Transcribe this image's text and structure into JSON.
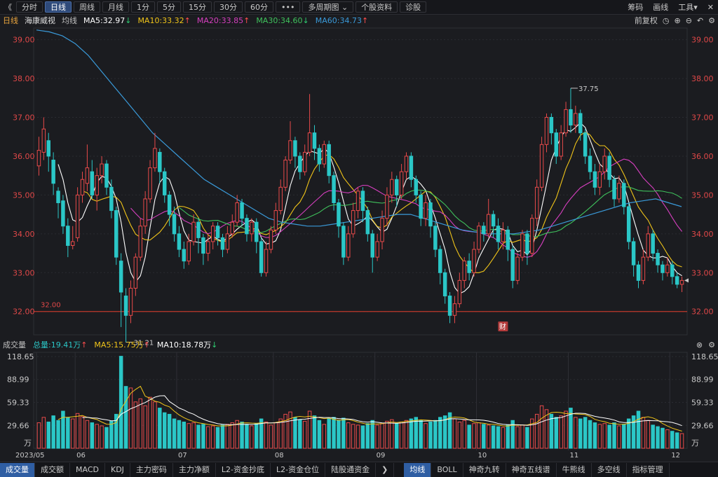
{
  "toolbar": {
    "back": "《",
    "tabs": [
      "分时",
      "日线",
      "周线",
      "月线",
      "1分",
      "5分",
      "15分",
      "30分",
      "60分",
      "•••",
      "多周期图 ⌄",
      "个股资料",
      "诊股"
    ],
    "active_tab": 1,
    "right_items": [
      "筹码",
      "画线",
      "工具▾"
    ],
    "close": "✕"
  },
  "legend": {
    "period": "日线",
    "stock_name": "海康威视",
    "ma_label": "均线",
    "ma": [
      {
        "text": "MA5:32.97",
        "arrow": "↓",
        "color": "#ffffff",
        "arrow_color": "#2ecc71"
      },
      {
        "text": "MA10:33.32",
        "arrow": "↑",
        "color": "#f0c419",
        "arrow_color": "#ff4d4d"
      },
      {
        "text": "MA20:33.85",
        "arrow": "↑",
        "color": "#d63fbf",
        "arrow_color": "#ff4d4d"
      },
      {
        "text": "MA30:34.60",
        "arrow": "↓",
        "color": "#3fc25c",
        "arrow_color": "#2ecc71"
      },
      {
        "text": "MA60:34.73",
        "arrow": "↑",
        "color": "#3a9ad9",
        "arrow_color": "#ff4d4d"
      }
    ],
    "right": [
      "前复权",
      "◷",
      "⊕",
      "⊖",
      "↶",
      "⚙"
    ]
  },
  "volume_legend": {
    "label": "成交量",
    "total": "总量:19.41万",
    "total_arrow": "↑",
    "ma5": "MA5:15.75万",
    "ma5_arrow": "↑",
    "ma10": "MA10:18.78万",
    "ma10_arrow": "↓",
    "right": [
      "⊗",
      "⚙"
    ]
  },
  "price_axis": {
    "ticks": [
      "39.00",
      "38.00",
      "37.00",
      "36.00",
      "35.00",
      "34.00",
      "33.00",
      "32.00"
    ],
    "reference_line_label": "32.00",
    "high_label": "37.75",
    "low_label": "31.21",
    "event_marker": "财"
  },
  "volume_axis": {
    "ticks": [
      "118.65",
      "88.99",
      "59.33",
      "29.66"
    ],
    "unit": "万"
  },
  "time_axis": {
    "labels": [
      "2023/05",
      "06",
      "07",
      "08",
      "09",
      "10",
      "11",
      "12"
    ]
  },
  "bottom_tabs": {
    "left": [
      "成交量",
      "成交额",
      "MACD",
      "KDJ",
      "主力密码",
      "主力净额",
      "L2-资金抄底",
      "L2-资金仓位",
      "陆股通资金",
      "❯"
    ],
    "right": [
      "均线",
      "BOLL",
      "神奇九转",
      "神奇五线谱",
      "牛熊线",
      "多空线",
      "指标管理"
    ],
    "active_left": 0,
    "active_right": 0
  },
  "colors": {
    "up": "#e84a4a",
    "down": "#2bc7c7",
    "ma5": "#ffffff",
    "ma10": "#f0c419",
    "ma20": "#d63fbf",
    "ma30": "#3fc25c",
    "ma60": "#3a9ad9",
    "reference": "#c0392b",
    "background": "#1b1c20"
  },
  "chart_data": {
    "type": "candlestick",
    "price_range": [
      31.4,
      39.3
    ],
    "volume_range": [
      0,
      118.65
    ],
    "reference_price": 32.0,
    "candles": [
      {
        "o": 35.75,
        "c": 36.15,
        "h": 36.5,
        "l": 35.5,
        "v": 33
      },
      {
        "o": 36.1,
        "c": 36.7,
        "h": 37.0,
        "l": 35.9,
        "v": 40
      },
      {
        "o": 36.4,
        "c": 36.0,
        "h": 36.6,
        "l": 35.6,
        "v": 34
      },
      {
        "o": 35.9,
        "c": 35.3,
        "h": 36.1,
        "l": 35.0,
        "v": 42
      },
      {
        "o": 35.1,
        "c": 34.8,
        "h": 35.2,
        "l": 34.4,
        "v": 36
      },
      {
        "o": 34.85,
        "c": 34.2,
        "h": 35.0,
        "l": 34.0,
        "v": 48
      },
      {
        "o": 34.2,
        "c": 33.7,
        "h": 34.4,
        "l": 33.4,
        "v": 40
      },
      {
        "o": 33.7,
        "c": 33.8,
        "h": 34.2,
        "l": 33.6,
        "v": 38
      },
      {
        "o": 33.9,
        "c": 35.0,
        "h": 35.2,
        "l": 33.8,
        "v": 45
      },
      {
        "o": 35.0,
        "c": 35.4,
        "h": 35.6,
        "l": 34.8,
        "v": 41
      },
      {
        "o": 35.3,
        "c": 35.7,
        "h": 36.3,
        "l": 35.1,
        "v": 36
      },
      {
        "o": 35.6,
        "c": 35.0,
        "h": 35.9,
        "l": 34.9,
        "v": 33
      },
      {
        "o": 35.0,
        "c": 35.5,
        "h": 35.7,
        "l": 34.6,
        "v": 31
      },
      {
        "o": 35.5,
        "c": 35.8,
        "h": 36.0,
        "l": 35.3,
        "v": 29
      },
      {
        "o": 35.8,
        "c": 35.2,
        "h": 35.9,
        "l": 35.0,
        "v": 27
      },
      {
        "o": 35.2,
        "c": 34.6,
        "h": 35.4,
        "l": 34.4,
        "v": 35
      },
      {
        "o": 34.6,
        "c": 33.4,
        "h": 34.7,
        "l": 33.2,
        "v": 44
      },
      {
        "o": 33.3,
        "c": 32.5,
        "h": 33.5,
        "l": 31.6,
        "v": 119
      },
      {
        "o": 32.4,
        "c": 31.9,
        "h": 32.6,
        "l": 31.21,
        "v": 80
      },
      {
        "o": 31.9,
        "c": 32.6,
        "h": 32.8,
        "l": 31.7,
        "v": 78
      },
      {
        "o": 32.6,
        "c": 33.4,
        "h": 33.5,
        "l": 32.4,
        "v": 60
      },
      {
        "o": 33.4,
        "c": 34.2,
        "h": 34.4,
        "l": 33.3,
        "v": 64
      },
      {
        "o": 34.2,
        "c": 34.9,
        "h": 35.1,
        "l": 34.0,
        "v": 55
      },
      {
        "o": 34.9,
        "c": 35.7,
        "h": 35.9,
        "l": 34.8,
        "v": 66
      },
      {
        "o": 35.7,
        "c": 36.2,
        "h": 36.6,
        "l": 35.6,
        "v": 60
      },
      {
        "o": 36.1,
        "c": 35.6,
        "h": 36.2,
        "l": 35.3,
        "v": 52
      },
      {
        "o": 35.6,
        "c": 35.0,
        "h": 35.7,
        "l": 34.8,
        "v": 46
      },
      {
        "o": 35.0,
        "c": 34.5,
        "h": 35.1,
        "l": 34.2,
        "v": 44
      },
      {
        "o": 34.5,
        "c": 34.0,
        "h": 34.7,
        "l": 33.8,
        "v": 38
      },
      {
        "o": 34.0,
        "c": 33.6,
        "h": 34.2,
        "l": 33.4,
        "v": 36
      },
      {
        "o": 33.6,
        "c": 33.3,
        "h": 33.8,
        "l": 33.1,
        "v": 34
      },
      {
        "o": 33.3,
        "c": 33.8,
        "h": 34.0,
        "l": 33.2,
        "v": 32
      },
      {
        "o": 33.8,
        "c": 34.3,
        "h": 34.5,
        "l": 33.7,
        "v": 33
      },
      {
        "o": 34.3,
        "c": 33.9,
        "h": 34.4,
        "l": 33.5,
        "v": 30
      },
      {
        "o": 33.9,
        "c": 33.5,
        "h": 34.0,
        "l": 33.2,
        "v": 31
      },
      {
        "o": 33.5,
        "c": 33.8,
        "h": 34.0,
        "l": 33.3,
        "v": 28
      },
      {
        "o": 33.8,
        "c": 34.2,
        "h": 34.3,
        "l": 33.6,
        "v": 29
      },
      {
        "o": 34.2,
        "c": 33.9,
        "h": 34.3,
        "l": 33.7,
        "v": 27
      },
      {
        "o": 33.9,
        "c": 33.6,
        "h": 34.0,
        "l": 33.4,
        "v": 30
      },
      {
        "o": 33.6,
        "c": 34.0,
        "h": 34.2,
        "l": 33.5,
        "v": 31
      },
      {
        "o": 34.0,
        "c": 34.3,
        "h": 34.5,
        "l": 33.9,
        "v": 33
      },
      {
        "o": 34.3,
        "c": 34.8,
        "h": 35.0,
        "l": 34.2,
        "v": 36
      },
      {
        "o": 34.8,
        "c": 34.4,
        "h": 34.9,
        "l": 34.2,
        "v": 34
      },
      {
        "o": 34.4,
        "c": 34.0,
        "h": 34.5,
        "l": 33.8,
        "v": 31
      },
      {
        "o": 34.0,
        "c": 34.3,
        "h": 34.4,
        "l": 33.8,
        "v": 29
      },
      {
        "o": 34.3,
        "c": 33.8,
        "h": 34.4,
        "l": 33.5,
        "v": 32
      },
      {
        "o": 33.8,
        "c": 33.0,
        "h": 33.9,
        "l": 32.9,
        "v": 38
      },
      {
        "o": 33.0,
        "c": 33.6,
        "h": 33.8,
        "l": 32.9,
        "v": 34
      },
      {
        "o": 33.6,
        "c": 34.1,
        "h": 34.2,
        "l": 33.5,
        "v": 30
      },
      {
        "o": 34.1,
        "c": 34.6,
        "h": 34.8,
        "l": 34.0,
        "v": 33
      },
      {
        "o": 34.6,
        "c": 35.2,
        "h": 35.4,
        "l": 34.5,
        "v": 38
      },
      {
        "o": 35.2,
        "c": 35.9,
        "h": 36.0,
        "l": 35.1,
        "v": 44
      },
      {
        "o": 35.9,
        "c": 36.4,
        "h": 36.9,
        "l": 35.8,
        "v": 47
      },
      {
        "o": 36.4,
        "c": 36.0,
        "h": 36.5,
        "l": 35.7,
        "v": 40
      },
      {
        "o": 36.0,
        "c": 35.6,
        "h": 36.1,
        "l": 35.4,
        "v": 37
      },
      {
        "o": 35.6,
        "c": 36.1,
        "h": 36.3,
        "l": 35.5,
        "v": 35
      },
      {
        "o": 36.1,
        "c": 36.6,
        "h": 37.6,
        "l": 36.0,
        "v": 48
      },
      {
        "o": 36.6,
        "c": 36.2,
        "h": 36.8,
        "l": 35.9,
        "v": 42
      },
      {
        "o": 36.2,
        "c": 35.8,
        "h": 36.3,
        "l": 35.6,
        "v": 36
      },
      {
        "o": 35.8,
        "c": 36.3,
        "h": 36.4,
        "l": 35.7,
        "v": 31
      },
      {
        "o": 36.3,
        "c": 35.5,
        "h": 36.4,
        "l": 35.3,
        "v": 38
      },
      {
        "o": 35.5,
        "c": 34.8,
        "h": 35.6,
        "l": 34.6,
        "v": 40
      },
      {
        "o": 34.8,
        "c": 34.2,
        "h": 34.9,
        "l": 33.9,
        "v": 36
      },
      {
        "o": 34.2,
        "c": 33.4,
        "h": 34.3,
        "l": 33.2,
        "v": 39
      },
      {
        "o": 33.4,
        "c": 34.0,
        "h": 34.2,
        "l": 33.3,
        "v": 33
      },
      {
        "o": 34.0,
        "c": 34.6,
        "h": 34.8,
        "l": 33.9,
        "v": 31
      },
      {
        "o": 34.6,
        "c": 35.1,
        "h": 35.2,
        "l": 34.4,
        "v": 30
      },
      {
        "o": 35.1,
        "c": 34.6,
        "h": 35.2,
        "l": 34.3,
        "v": 29
      },
      {
        "o": 34.6,
        "c": 34.0,
        "h": 34.7,
        "l": 33.8,
        "v": 32
      },
      {
        "o": 34.0,
        "c": 33.4,
        "h": 34.1,
        "l": 33.0,
        "v": 36
      },
      {
        "o": 33.4,
        "c": 33.8,
        "h": 34.0,
        "l": 33.3,
        "v": 30
      },
      {
        "o": 33.8,
        "c": 34.4,
        "h": 34.6,
        "l": 33.6,
        "v": 32
      },
      {
        "o": 34.4,
        "c": 35.0,
        "h": 35.2,
        "l": 34.2,
        "v": 35
      },
      {
        "o": 35.0,
        "c": 35.4,
        "h": 35.6,
        "l": 34.8,
        "v": 37
      },
      {
        "o": 35.4,
        "c": 35.0,
        "h": 35.5,
        "l": 34.7,
        "v": 32
      },
      {
        "o": 35.0,
        "c": 35.6,
        "h": 35.8,
        "l": 34.9,
        "v": 34
      },
      {
        "o": 35.6,
        "c": 36.0,
        "h": 36.1,
        "l": 35.4,
        "v": 36
      },
      {
        "o": 36.0,
        "c": 35.4,
        "h": 36.1,
        "l": 35.2,
        "v": 38
      },
      {
        "o": 35.4,
        "c": 35.0,
        "h": 35.5,
        "l": 34.8,
        "v": 40
      },
      {
        "o": 35.0,
        "c": 34.4,
        "h": 35.1,
        "l": 34.2,
        "v": 36
      },
      {
        "o": 34.4,
        "c": 34.8,
        "h": 35.0,
        "l": 34.2,
        "v": 32
      },
      {
        "o": 34.8,
        "c": 34.2,
        "h": 34.9,
        "l": 33.9,
        "v": 34
      },
      {
        "o": 34.2,
        "c": 33.6,
        "h": 34.3,
        "l": 33.4,
        "v": 36
      },
      {
        "o": 33.6,
        "c": 33.0,
        "h": 33.7,
        "l": 32.7,
        "v": 40
      },
      {
        "o": 33.0,
        "c": 32.4,
        "h": 33.1,
        "l": 32.2,
        "v": 42
      },
      {
        "o": 32.4,
        "c": 31.9,
        "h": 32.5,
        "l": 31.7,
        "v": 46
      },
      {
        "o": 31.9,
        "c": 32.2,
        "h": 32.4,
        "l": 31.7,
        "v": 38
      },
      {
        "o": 32.2,
        "c": 32.8,
        "h": 33.0,
        "l": 32.1,
        "v": 34
      },
      {
        "o": 32.8,
        "c": 33.3,
        "h": 33.4,
        "l": 32.6,
        "v": 36
      },
      {
        "o": 33.3,
        "c": 33.0,
        "h": 33.5,
        "l": 32.8,
        "v": 30
      },
      {
        "o": 33.0,
        "c": 33.6,
        "h": 33.8,
        "l": 32.9,
        "v": 32
      },
      {
        "o": 33.6,
        "c": 34.2,
        "h": 34.3,
        "l": 33.5,
        "v": 33
      },
      {
        "o": 34.2,
        "c": 34.0,
        "h": 34.3,
        "l": 33.8,
        "v": 31
      },
      {
        "o": 34.0,
        "c": 34.5,
        "h": 34.9,
        "l": 33.9,
        "v": 30
      },
      {
        "o": 34.5,
        "c": 34.2,
        "h": 34.6,
        "l": 33.9,
        "v": 29
      },
      {
        "o": 34.2,
        "c": 33.8,
        "h": 34.4,
        "l": 33.6,
        "v": 28
      },
      {
        "o": 33.8,
        "c": 34.1,
        "h": 34.3,
        "l": 33.6,
        "v": 27
      },
      {
        "o": 34.1,
        "c": 33.6,
        "h": 34.2,
        "l": 33.3,
        "v": 30
      },
      {
        "o": 33.6,
        "c": 32.8,
        "h": 33.7,
        "l": 32.6,
        "v": 36
      },
      {
        "o": 32.8,
        "c": 33.4,
        "h": 33.5,
        "l": 32.7,
        "v": 28
      },
      {
        "o": 33.4,
        "c": 34.0,
        "h": 34.1,
        "l": 33.3,
        "v": 30
      },
      {
        "o": 34.0,
        "c": 33.5,
        "h": 34.1,
        "l": 33.2,
        "v": 27
      },
      {
        "o": 33.5,
        "c": 34.4,
        "h": 34.5,
        "l": 33.4,
        "v": 38
      },
      {
        "o": 34.4,
        "c": 35.2,
        "h": 35.4,
        "l": 34.2,
        "v": 44
      },
      {
        "o": 35.2,
        "c": 36.3,
        "h": 36.5,
        "l": 35.1,
        "v": 55
      },
      {
        "o": 36.3,
        "c": 37.0,
        "h": 37.1,
        "l": 36.1,
        "v": 50
      },
      {
        "o": 37.0,
        "c": 36.6,
        "h": 37.1,
        "l": 36.3,
        "v": 44
      },
      {
        "o": 36.6,
        "c": 36.0,
        "h": 36.7,
        "l": 35.8,
        "v": 40
      },
      {
        "o": 36.0,
        "c": 36.6,
        "h": 36.8,
        "l": 35.9,
        "v": 42
      },
      {
        "o": 36.6,
        "c": 37.2,
        "h": 37.4,
        "l": 36.5,
        "v": 48
      },
      {
        "o": 37.2,
        "c": 36.8,
        "h": 37.75,
        "l": 36.6,
        "v": 52
      },
      {
        "o": 36.8,
        "c": 37.1,
        "h": 37.3,
        "l": 36.6,
        "v": 40
      },
      {
        "o": 37.1,
        "c": 36.6,
        "h": 37.2,
        "l": 36.4,
        "v": 38
      },
      {
        "o": 36.6,
        "c": 36.0,
        "h": 36.7,
        "l": 35.8,
        "v": 40
      },
      {
        "o": 36.0,
        "c": 35.6,
        "h": 36.2,
        "l": 35.4,
        "v": 36
      },
      {
        "o": 35.6,
        "c": 35.2,
        "h": 35.8,
        "l": 35.0,
        "v": 33
      },
      {
        "o": 35.2,
        "c": 35.6,
        "h": 35.8,
        "l": 35.0,
        "v": 31
      },
      {
        "o": 35.6,
        "c": 36.0,
        "h": 36.2,
        "l": 35.4,
        "v": 32
      },
      {
        "o": 36.0,
        "c": 35.4,
        "h": 36.1,
        "l": 35.2,
        "v": 30
      },
      {
        "o": 35.4,
        "c": 34.9,
        "h": 35.5,
        "l": 34.7,
        "v": 33
      },
      {
        "o": 34.9,
        "c": 35.3,
        "h": 35.5,
        "l": 34.8,
        "v": 29
      },
      {
        "o": 35.3,
        "c": 34.7,
        "h": 35.4,
        "l": 34.5,
        "v": 31
      },
      {
        "o": 34.7,
        "c": 33.8,
        "h": 34.8,
        "l": 33.6,
        "v": 38
      },
      {
        "o": 33.8,
        "c": 33.2,
        "h": 33.9,
        "l": 32.9,
        "v": 42
      },
      {
        "o": 33.2,
        "c": 32.8,
        "h": 33.3,
        "l": 32.6,
        "v": 48
      },
      {
        "o": 32.8,
        "c": 33.4,
        "h": 33.6,
        "l": 32.7,
        "v": 40
      },
      {
        "o": 33.4,
        "c": 34.0,
        "h": 34.2,
        "l": 33.3,
        "v": 36
      },
      {
        "o": 34.0,
        "c": 33.5,
        "h": 34.1,
        "l": 33.3,
        "v": 30
      },
      {
        "o": 33.5,
        "c": 33.2,
        "h": 33.6,
        "l": 33.0,
        "v": 28
      },
      {
        "o": 33.2,
        "c": 33.0,
        "h": 33.3,
        "l": 32.8,
        "v": 26
      },
      {
        "o": 33.0,
        "c": 33.2,
        "h": 33.4,
        "l": 32.9,
        "v": 24
      },
      {
        "o": 33.2,
        "c": 32.9,
        "h": 33.3,
        "l": 32.7,
        "v": 22
      },
      {
        "o": 32.9,
        "c": 32.7,
        "h": 33.0,
        "l": 32.6,
        "v": 20
      },
      {
        "o": 32.7,
        "c": 32.8,
        "h": 32.9,
        "l": 32.5,
        "v": 19
      }
    ],
    "ma60": [
      39.25,
      39.2,
      39.1,
      38.9,
      38.6,
      38.2,
      37.8,
      37.4,
      37.0,
      36.6,
      36.3,
      36.0,
      35.7,
      35.4,
      35.2,
      35.0,
      34.8,
      34.6,
      34.4,
      34.3,
      34.25,
      34.2,
      34.2,
      34.25,
      34.3,
      34.35,
      34.4,
      34.45,
      34.5,
      34.5,
      34.4,
      34.3,
      34.2,
      34.1,
      34.05,
      34.0,
      34.0,
      34.0,
      34.05,
      34.1,
      34.2,
      34.3,
      34.4,
      34.5,
      34.6,
      34.7,
      34.8,
      34.85,
      34.9,
      34.8,
      34.7
    ],
    "volume_ma5": [
      33,
      35,
      37,
      38,
      40,
      40,
      39,
      40,
      42,
      41,
      39,
      37,
      36,
      35,
      33,
      32,
      36,
      55,
      72,
      84,
      87,
      80,
      67,
      64,
      60,
      56,
      52,
      48,
      45,
      41,
      38,
      35,
      33,
      32,
      32,
      31,
      30,
      29,
      29,
      29,
      29,
      30,
      31,
      33,
      34,
      33,
      32,
      33,
      34,
      35,
      37,
      39,
      41,
      41,
      40,
      40,
      41,
      41,
      39,
      38,
      37,
      37,
      37,
      36,
      36,
      35,
      34,
      33,
      32,
      32,
      32,
      32,
      33,
      34,
      34,
      35,
      35,
      36,
      38,
      38,
      37,
      36,
      36,
      37,
      39,
      41,
      42,
      40,
      38,
      36,
      34,
      32,
      31,
      31,
      30,
      29,
      29,
      30,
      30,
      30,
      30,
      32,
      35,
      40,
      44,
      47,
      47,
      46,
      46,
      46,
      45,
      43,
      41,
      39,
      37,
      35,
      33,
      31,
      31,
      31,
      31,
      32,
      34,
      37,
      41,
      42,
      41,
      39,
      36,
      31,
      27,
      24,
      22,
      21
    ]
  }
}
